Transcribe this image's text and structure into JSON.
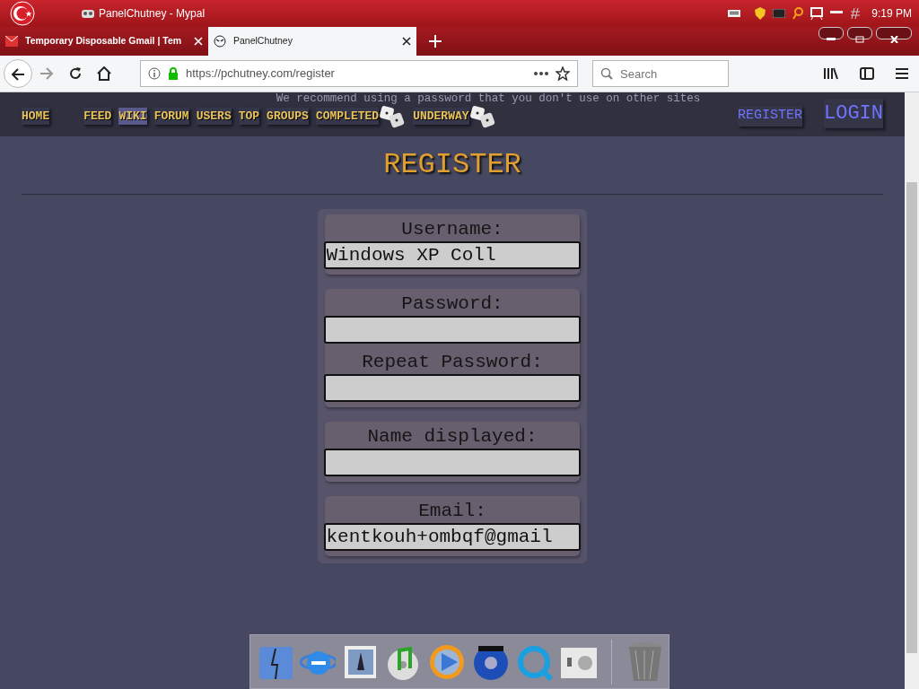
{
  "window": {
    "title": "PanelChutney - Mypal",
    "clock": "9:19 PM"
  },
  "tabs": [
    {
      "label": "Temporary Disposable Gmail | Tem",
      "selected": false
    },
    {
      "label": "PanelChutney",
      "selected": true
    }
  ],
  "address_bar": {
    "url": "https://pchutney.com/register"
  },
  "search": {
    "placeholder": "Search"
  },
  "site_nav": {
    "notice": "We recommend using a password that you don't use on other sites",
    "items": [
      {
        "label": "HOME",
        "selected": false
      },
      {
        "label": "FEED",
        "selected": false
      },
      {
        "label": "WIKI",
        "selected": true
      },
      {
        "label": "FORUM",
        "selected": false
      },
      {
        "label": "USERS",
        "selected": false
      },
      {
        "label": "TOP",
        "selected": false
      },
      {
        "label": "GROUPS",
        "selected": false
      },
      {
        "label": "COMPLETED",
        "selected": false
      },
      {
        "label": "UNDERWAY",
        "selected": false
      }
    ],
    "register": "REGISTER",
    "login": "LOGIN"
  },
  "heading": "REGISTER",
  "form_groups": [
    {
      "fields": [
        {
          "label": "Username:",
          "value": "Windows XP Coll"
        }
      ]
    },
    {
      "fields": [
        {
          "label": "Password:"
        },
        {
          "label": "Repeat Password:"
        }
      ]
    },
    {
      "fields": [
        {
          "label": "Name displayed:"
        }
      ]
    },
    {
      "fields": [
        {
          "label": "Email:",
          "value": "kentkouh+ombqf@gmail"
        }
      ]
    }
  ]
}
